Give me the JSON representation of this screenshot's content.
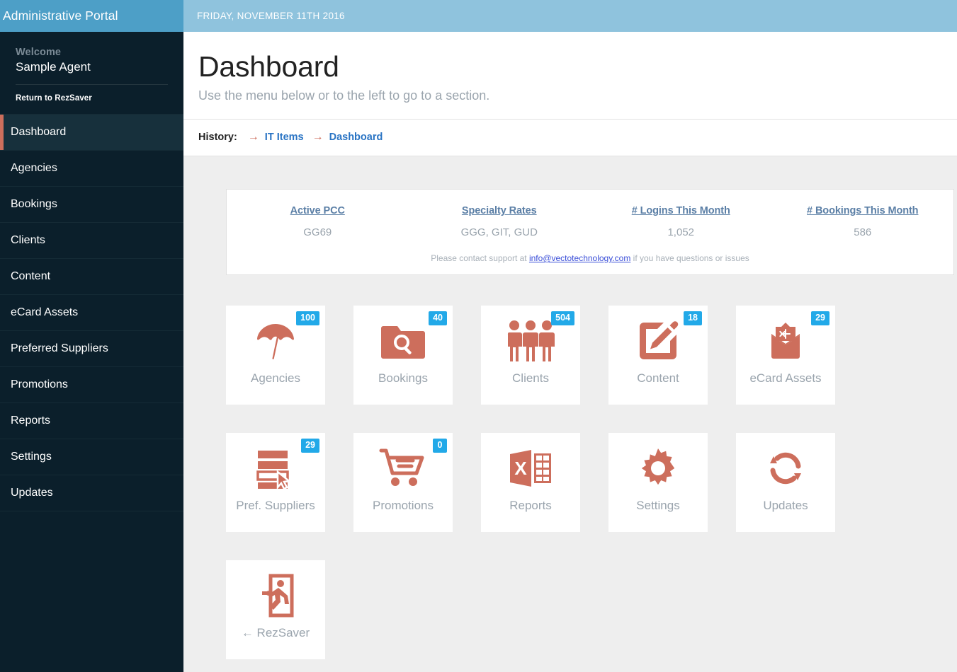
{
  "sidebar": {
    "brand_title": "Administrative Portal",
    "welcome_label": "Welcome",
    "user_name": "Sample Agent",
    "return_link": "Return to RezSaver",
    "items": [
      {
        "label": "Dashboard",
        "active": true
      },
      {
        "label": "Agencies",
        "active": false
      },
      {
        "label": "Bookings",
        "active": false
      },
      {
        "label": "Clients",
        "active": false
      },
      {
        "label": "Content",
        "active": false
      },
      {
        "label": "eCard Assets",
        "active": false
      },
      {
        "label": "Preferred Suppliers",
        "active": false
      },
      {
        "label": "Promotions",
        "active": false
      },
      {
        "label": "Reports",
        "active": false
      },
      {
        "label": "Settings",
        "active": false
      },
      {
        "label": "Updates",
        "active": false
      }
    ]
  },
  "topbar": {
    "date": "FRIDAY, NOVEMBER 11TH 2016"
  },
  "page": {
    "title": "Dashboard",
    "subtitle": "Use the menu below or to the left to go to a section."
  },
  "history": {
    "label": "History:",
    "arrow": "→",
    "items": [
      {
        "label": "IT Items"
      },
      {
        "label": "Dashboard"
      }
    ]
  },
  "stats": {
    "columns": [
      {
        "title": "Active PCC",
        "value": "GG69"
      },
      {
        "title": "Specialty Rates",
        "value": "GGG, GIT, GUD"
      },
      {
        "title": "# Logins This Month",
        "value": "1,052"
      },
      {
        "title": "# Bookings This Month",
        "value": "586"
      }
    ],
    "footer_before": "Please contact support at ",
    "footer_email": "info@vectotechnology.com",
    "footer_after": " if you have questions or issues"
  },
  "tiles": [
    {
      "label": "Agencies",
      "badge": "100",
      "icon": "umbrella-icon"
    },
    {
      "label": "Bookings",
      "badge": "40",
      "icon": "folder-search-icon"
    },
    {
      "label": "Clients",
      "badge": "504",
      "icon": "people-icon"
    },
    {
      "label": "Content",
      "badge": "18",
      "icon": "edit-square-icon"
    },
    {
      "label": "eCard Assets",
      "badge": "29",
      "icon": "envelope-card-icon"
    },
    {
      "label": "Pref. Suppliers",
      "badge": "29",
      "icon": "list-select-icon"
    },
    {
      "label": "Promotions",
      "badge": "0",
      "icon": "shopping-cart-icon"
    },
    {
      "label": "Reports",
      "badge": null,
      "icon": "spreadsheet-icon"
    },
    {
      "label": "Settings",
      "badge": null,
      "icon": "gear-icon"
    },
    {
      "label": "Updates",
      "badge": null,
      "icon": "refresh-icon"
    },
    {
      "label": "← RezSaver",
      "badge": null,
      "icon": "exit-door-icon"
    }
  ],
  "colors": {
    "brand_blue": "#4d9fc7",
    "topbar_blue": "#8fc3dd",
    "sidebar_dark": "#0b1f2b",
    "accent_salmon": "#cd6e5c",
    "badge_blue": "#22a9e8",
    "link_blue": "#2a74c4"
  }
}
